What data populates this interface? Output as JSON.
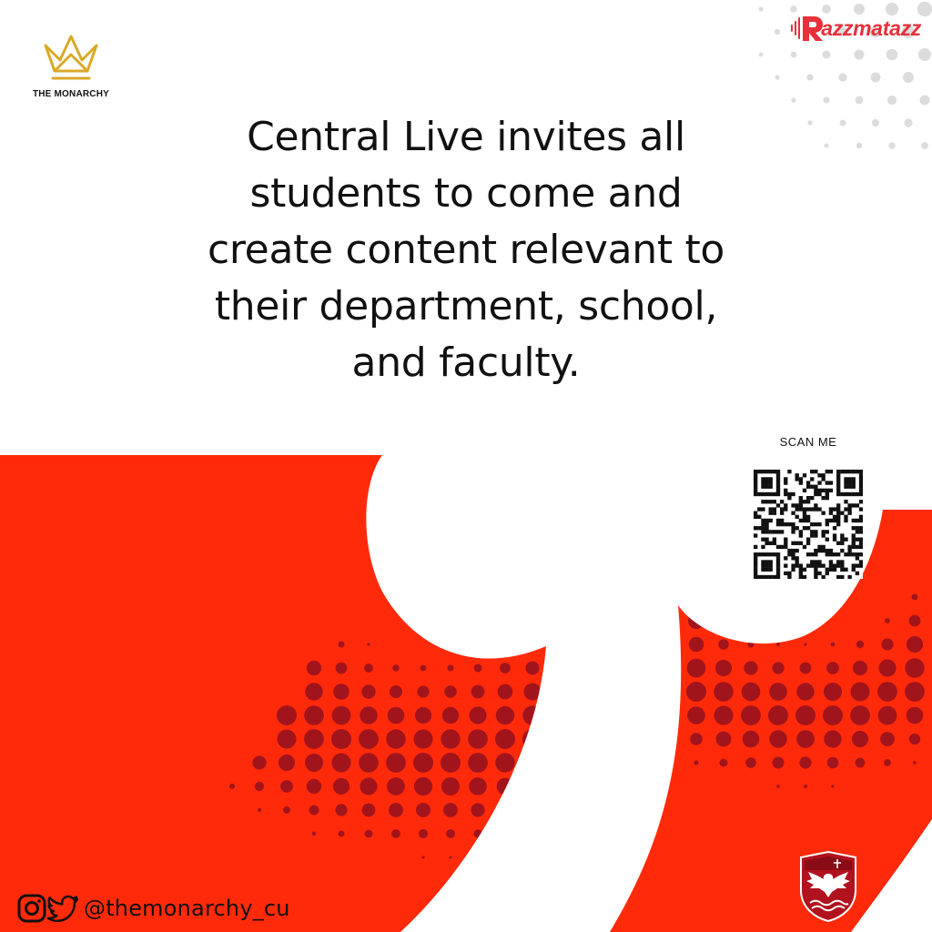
{
  "brand": {
    "monarchy_name": "THE MONARCHY",
    "monarchy_icon": "crown-icon",
    "razz_initial": "R",
    "razz_name": "azzmatazz",
    "razz_icon": "soundwave-icon"
  },
  "headline": {
    "lines": [
      "Central Live invites all",
      "students to come and",
      "create content relevant to",
      "their department, school,",
      "and faculty."
    ]
  },
  "scan": {
    "label": "SCAN ME",
    "qr_icon": "qr-code-icon"
  },
  "social": {
    "handle": "@themonarchy_cu",
    "icons": [
      "instagram-icon",
      "twitter-icon"
    ]
  },
  "crest": {
    "icon": "eagle-crest-icon"
  },
  "colors": {
    "red": "#ff2a0a",
    "dark_red": "#a2141c",
    "gold": "#d9a928",
    "text": "#111111",
    "razz_red": "#e8303a",
    "dots_gray": "#dcdcdc"
  }
}
